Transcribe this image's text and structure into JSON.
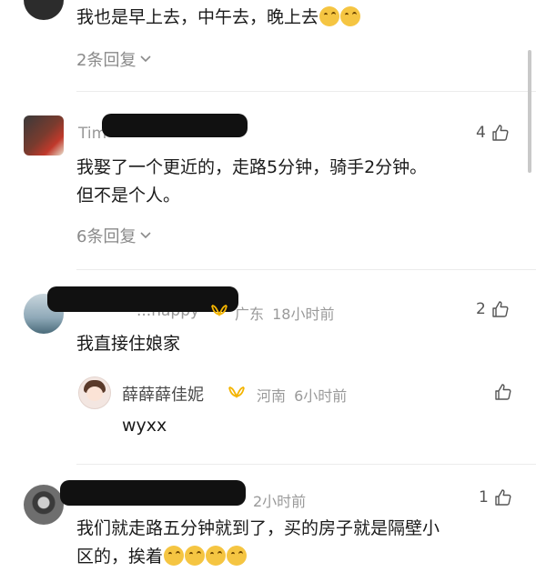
{
  "comments": [
    {
      "text": "我也是早上去，中午去，晚上去",
      "emoji_count": 2,
      "replies_label": "2条回复"
    },
    {
      "name_visible": "Tim",
      "likes": "4",
      "text_line1": "我娶了一个更近的，走路5分钟，骑手2分钟。",
      "text_line2": "但不是个人。",
      "replies_label": "6条回复"
    },
    {
      "name_visible": "...happy",
      "location": "广东",
      "time": "18小时前",
      "likes": "2",
      "text": "我直接住娘家",
      "reply": {
        "name": "薛薛薛佳妮",
        "location": "河南",
        "time": "6小时前",
        "text": "wyxx"
      }
    },
    {
      "time": "2小时前",
      "likes": "1",
      "text_line1": "我们就走路五分钟就到了，买的房子就是隔壁小",
      "text_line2": "区的，挨着",
      "emoji_count": 4
    }
  ],
  "colors": {
    "badge": "#f4b400",
    "meta": "#9a9a9a",
    "text": "#1a1a1a"
  },
  "icons": [
    "thumb-up-icon",
    "chevron-down-icon",
    "badge-icon"
  ]
}
